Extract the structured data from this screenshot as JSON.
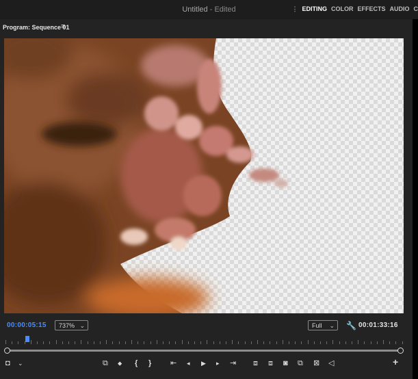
{
  "app": {
    "title_main": "Untitled",
    "title_sep": " - ",
    "title_state": "Edited",
    "workspaces": [
      "EDITING",
      "COLOR",
      "EFFECTS",
      "AUDIO",
      "C"
    ],
    "active_workspace": "EDITING"
  },
  "panel": {
    "title": "Program: Sequence 01",
    "menu_icon": "hamburger-menu-icon",
    "current_timecode": "00:00:05:15",
    "zoom_value": "737%",
    "resolution_value": "Full",
    "duration_timecode": "00:01:33:16"
  },
  "controls": {
    "left": [
      {
        "name": "export-settings-icon",
        "glyph": "◘"
      },
      {
        "name": "settings-chevron-icon",
        "glyph": "⌄"
      }
    ],
    "main": [
      {
        "name": "insert-frame-icon",
        "glyph": "⧉"
      },
      {
        "name": "add-marker-icon",
        "glyph": "⬥"
      },
      {
        "name": "mark-in-icon",
        "glyph": "{"
      },
      {
        "name": "mark-out-icon",
        "glyph": "}"
      },
      {
        "name": "go-to-in-icon",
        "glyph": "⇤"
      },
      {
        "name": "step-back-icon",
        "glyph": "◂"
      },
      {
        "name": "play-icon",
        "glyph": "▶"
      },
      {
        "name": "step-forward-icon",
        "glyph": "▸"
      },
      {
        "name": "go-to-out-icon",
        "glyph": "⇥"
      },
      {
        "name": "lift-icon",
        "glyph": "⧈"
      },
      {
        "name": "extract-icon",
        "glyph": "⧈"
      },
      {
        "name": "export-frame-icon",
        "glyph": "⧆"
      },
      {
        "name": "comparison-view-icon",
        "glyph": "⧉"
      },
      {
        "name": "safe-margins-icon",
        "glyph": "⊠"
      },
      {
        "name": "audio-icon",
        "glyph": "◁"
      }
    ],
    "add_button": "+"
  },
  "scrub": {
    "playhead_fraction": 0.06
  }
}
